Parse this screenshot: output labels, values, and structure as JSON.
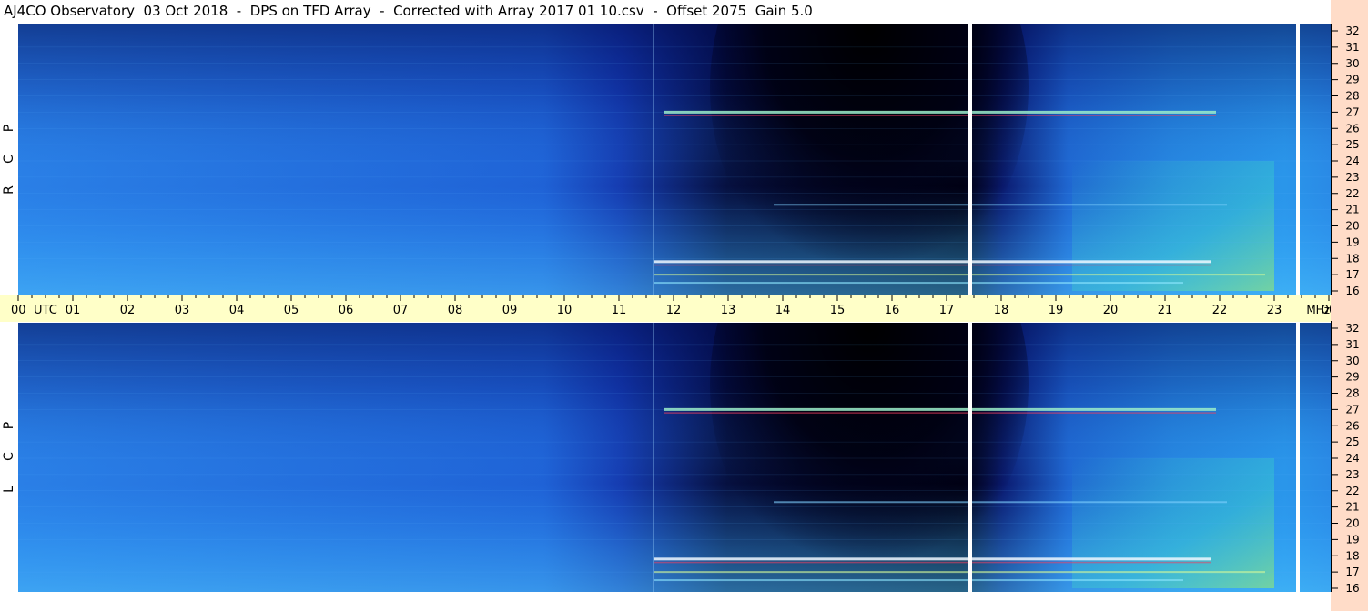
{
  "title": "AJ4CO Observatory  03 Oct 2018  -  DPS on TFD Array  -  Corrected with Array 2017 01 10.csv  -  Offset 2075  Gain 5.0",
  "channels": [
    {
      "id": "rcp",
      "letters": [
        "R",
        "C",
        "P"
      ]
    },
    {
      "id": "lcp",
      "letters": [
        "L",
        "C",
        "P"
      ]
    }
  ],
  "colors": {
    "background_blue": "#2a7be8",
    "deep_blue": "#1033b0",
    "night_black": "#000018",
    "cyan": "#22aaf5",
    "axis_band": "#ffffc8",
    "freq_strip": "#ffdcc8"
  },
  "chart_data": {
    "type": "heatmap",
    "title": "AJ4CO Observatory  03 Oct 2018  -  DPS on TFD Array  -  Corrected with Array 2017 01 10.csv  -  Offset 2075  Gain 5.0",
    "x_axis": {
      "unit_label": "UTC",
      "ticks": [
        "00",
        "01",
        "02",
        "03",
        "04",
        "05",
        "06",
        "07",
        "08",
        "09",
        "10",
        "11",
        "12",
        "13",
        "14",
        "15",
        "16",
        "17",
        "18",
        "19",
        "20",
        "21",
        "22",
        "23",
        "00"
      ],
      "range_hours": [
        0,
        24
      ]
    },
    "y_axis": {
      "unit_label": "MHz",
      "ticks": [
        "32",
        "31",
        "30",
        "29",
        "28",
        "27",
        "26",
        "25",
        "24",
        "23",
        "22",
        "21",
        "20",
        "19",
        "18",
        "17",
        "16"
      ],
      "range_mhz": [
        16,
        32
      ]
    },
    "panels": [
      "RCP",
      "LCP"
    ],
    "features": [
      {
        "name": "night",
        "start_hour": 11.3,
        "end_hour": 18.0
      },
      {
        "name": "dark core",
        "start_hour": 13.5,
        "end_hour": 17.0
      },
      {
        "name": "gap",
        "hour": 17.1
      },
      {
        "name": "gap",
        "hour": 23.1
      },
      {
        "name": "interference 18 MHz",
        "mhz": 17.8,
        "start_hour": 11.3,
        "end_hour": 21.5
      },
      {
        "name": "interference 27 MHz",
        "mhz": 27.0,
        "start_hour": 11.5,
        "end_hour": 21.6
      }
    ]
  }
}
